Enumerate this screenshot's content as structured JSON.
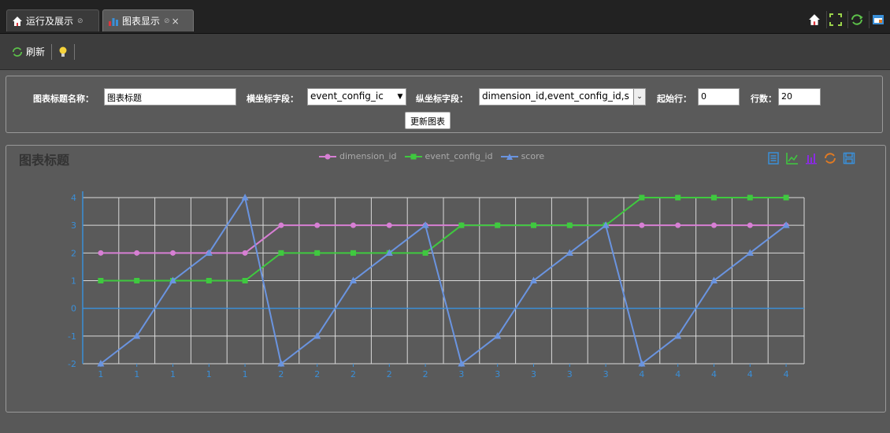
{
  "tabs": [
    {
      "label": "运行及展示",
      "icon": "home-icon",
      "marker": "⊘"
    },
    {
      "label": "图表显示",
      "icon": "bar-chart-icon",
      "marker": "⊘",
      "close": "×"
    }
  ],
  "top_icons": [
    "home-icon",
    "fullscreen-icon",
    "refresh-icon",
    "window-icon"
  ],
  "toolbar": {
    "refresh_label": "刷新",
    "hint_icon": "lightbulb-icon"
  },
  "form": {
    "title_label": "图表标题名称：",
    "title_value": "图表标题",
    "x_label": "横坐标字段：",
    "x_value": "event_config_ic",
    "y_label": "纵坐标字段：",
    "y_value": "dimension_id,event_config_id,s",
    "start_label": "起始行：",
    "start_value": "0",
    "rows_label": "行数：",
    "rows_value": "20",
    "update_button": "更新图表"
  },
  "chart_tool_icons": [
    "data-view-icon",
    "line-chart-icon",
    "bar-chart-icon",
    "restore-icon",
    "save-image-icon"
  ],
  "colors": {
    "dimension_id": "#d77fd4",
    "event_config_id": "#3fc93f",
    "score": "#6a94e0",
    "tools": "#3a8fd8",
    "tools_warn": "#e07a23"
  },
  "chart_data": {
    "type": "line",
    "title": "图表标题",
    "categories": [
      "1",
      "1",
      "1",
      "1",
      "1",
      "2",
      "2",
      "2",
      "2",
      "2",
      "3",
      "3",
      "3",
      "3",
      "3",
      "4",
      "4",
      "4",
      "4",
      "4"
    ],
    "series": [
      {
        "name": "dimension_id",
        "marker": "circle",
        "values": [
          2,
          2,
          2,
          2,
          2,
          3,
          3,
          3,
          3,
          3,
          3,
          3,
          3,
          3,
          3,
          3,
          3,
          3,
          3,
          3
        ]
      },
      {
        "name": "event_config_id",
        "marker": "square",
        "values": [
          1,
          1,
          1,
          1,
          1,
          2,
          2,
          2,
          2,
          2,
          3,
          3,
          3,
          3,
          3,
          4,
          4,
          4,
          4,
          4
        ]
      },
      {
        "name": "score",
        "marker": "triangle",
        "values": [
          -2,
          -1,
          1,
          2,
          4,
          -2,
          -1,
          1,
          2,
          3,
          -2,
          -1,
          1,
          2,
          3,
          -2,
          -1,
          1,
          2,
          3
        ]
      }
    ],
    "yticks": [
      -2,
      -1,
      0,
      1,
      2,
      3,
      4
    ],
    "ylim": [
      -2,
      4
    ],
    "grid": true,
    "legend": "top-center"
  }
}
